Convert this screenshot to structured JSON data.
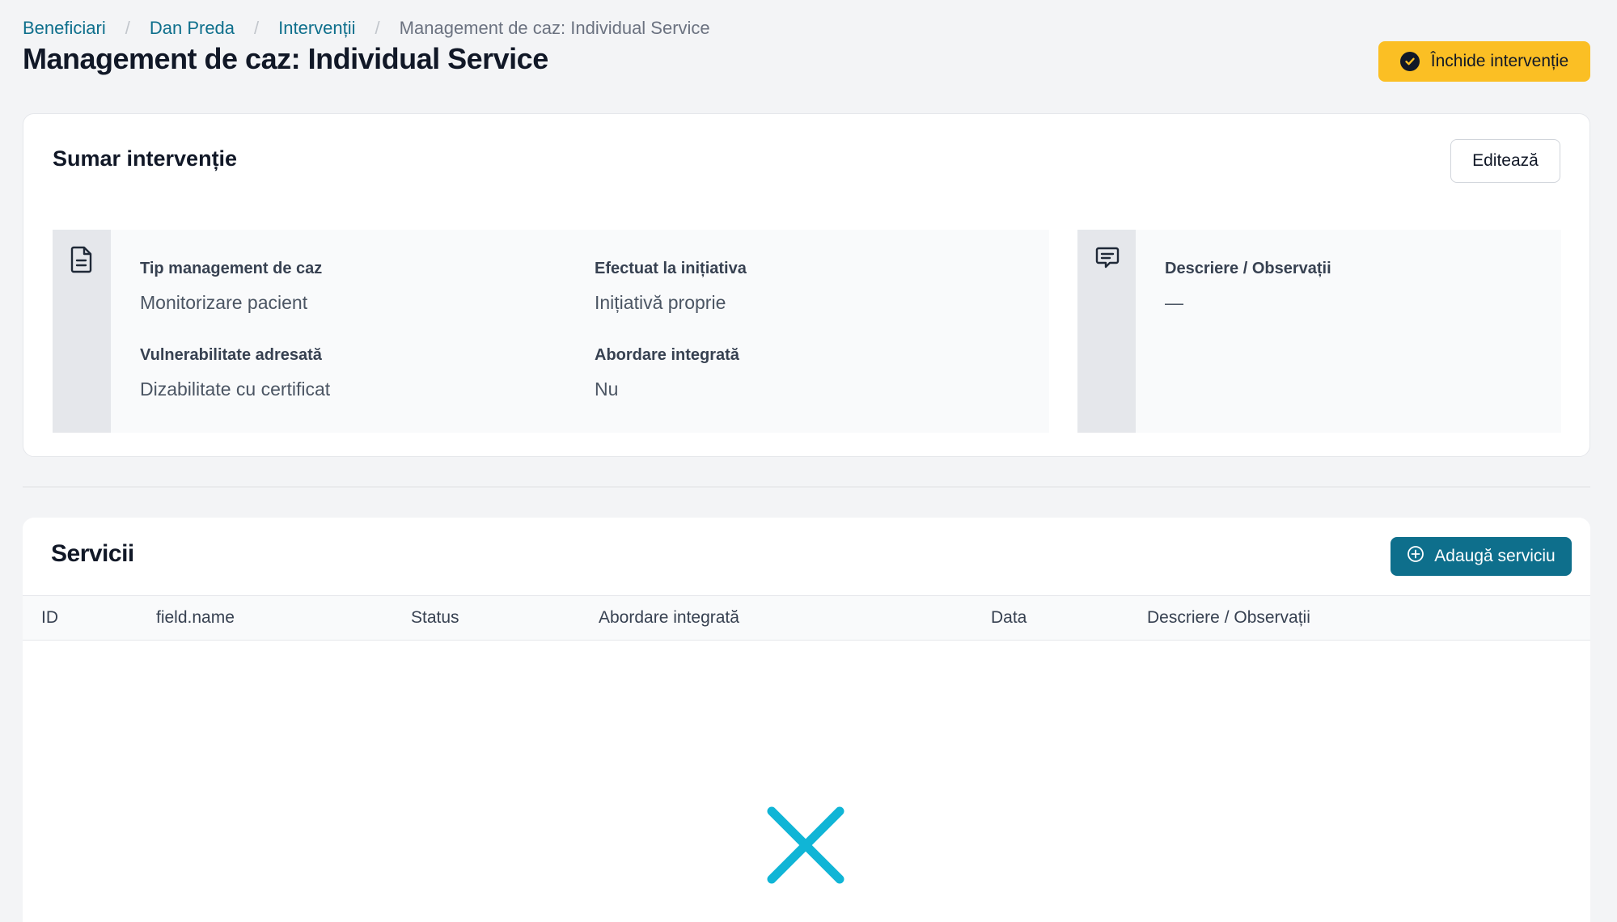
{
  "breadcrumb": {
    "items": [
      "Beneficiari",
      "Dan Preda",
      "Intervenții"
    ],
    "separator": "/",
    "current": "Management de caz: Individual Service"
  },
  "header": {
    "title": "Management de caz: Individual Service",
    "close_button": "Închide intervenție"
  },
  "summary": {
    "title": "Sumar intervenție",
    "edit_button": "Editează",
    "fields": {
      "tip": {
        "label": "Tip management de caz",
        "value": "Monitorizare pacient"
      },
      "initiativa": {
        "label": "Efectuat la inițiativa",
        "value": "Inițiativă proprie"
      },
      "vulnerabilitate": {
        "label": "Vulnerabilitate adresată",
        "value": "Dizabilitate cu certificat"
      },
      "abordare": {
        "label": "Abordare integrată",
        "value": "Nu"
      }
    },
    "description": {
      "label": "Descriere / Observații",
      "value": "—"
    }
  },
  "services": {
    "title": "Servicii",
    "add_button": "Adaugă serviciu",
    "columns": [
      "ID",
      "field.name",
      "Status",
      "Abordare integrată",
      "Data",
      "Descriere / Observații"
    ],
    "rows": []
  },
  "colors": {
    "primary": "#0e6f8c",
    "warning": "#fbbf24",
    "empty_state_icon": "#10b5d6"
  },
  "icons": {
    "close_button": "check-circle-icon",
    "summary_info": "document-icon",
    "summary_description": "comment-icon",
    "add_button": "plus-circle-icon",
    "empty_state": "x-icon"
  }
}
